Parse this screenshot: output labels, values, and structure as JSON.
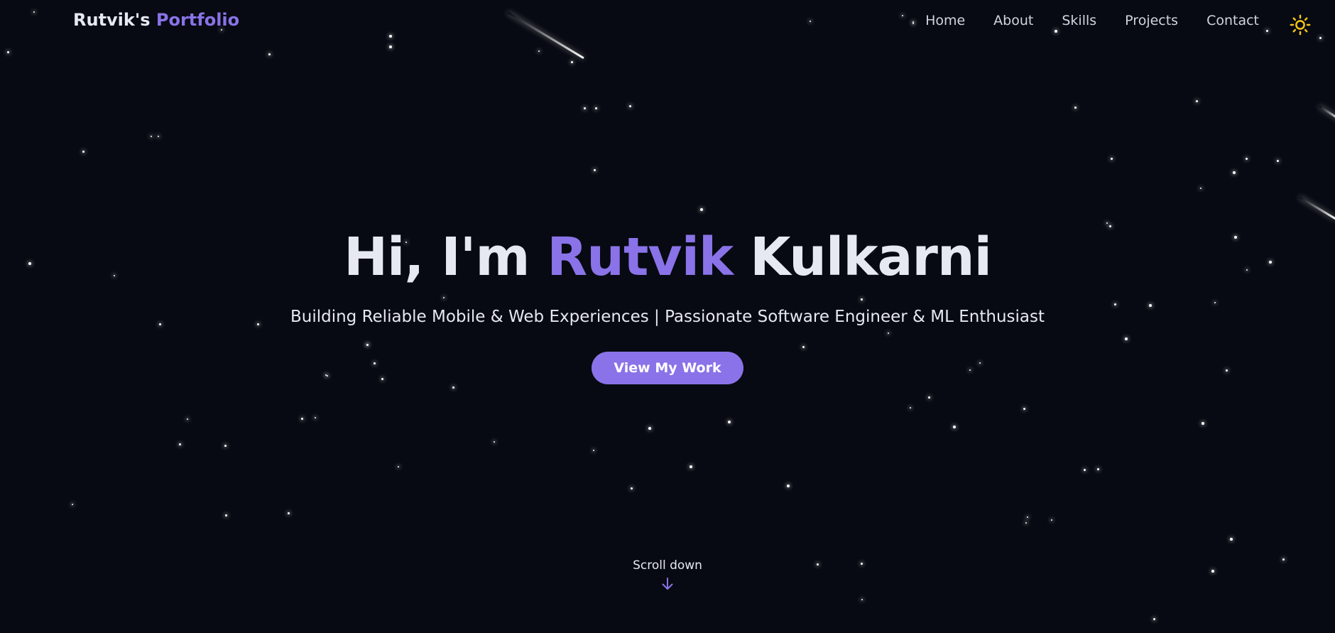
{
  "brand": {
    "name": "Rutvik's",
    "accent": "Portfolio"
  },
  "nav": {
    "items": [
      {
        "label": "Home"
      },
      {
        "label": "About"
      },
      {
        "label": "Skills"
      },
      {
        "label": "Projects"
      },
      {
        "label": "Contact"
      }
    ],
    "theme_toggle_icon": "sun-icon"
  },
  "hero": {
    "greeting": "Hi, I'm",
    "first_name": "Rutvik",
    "last_name": "Kulkarni",
    "subtitle": "Building Reliable Mobile & Web Experiences | Passionate Software Engineer & ML Enthusiast",
    "cta_label": "View My Work"
  },
  "scroll": {
    "label": "Scroll down",
    "icon": "arrow-down-icon"
  },
  "colors": {
    "background": "#070a12",
    "accent": "#8a73e8",
    "text": "#e6e8f2",
    "nav_text": "#d1d4de",
    "sun_icon": "#f5c518"
  }
}
